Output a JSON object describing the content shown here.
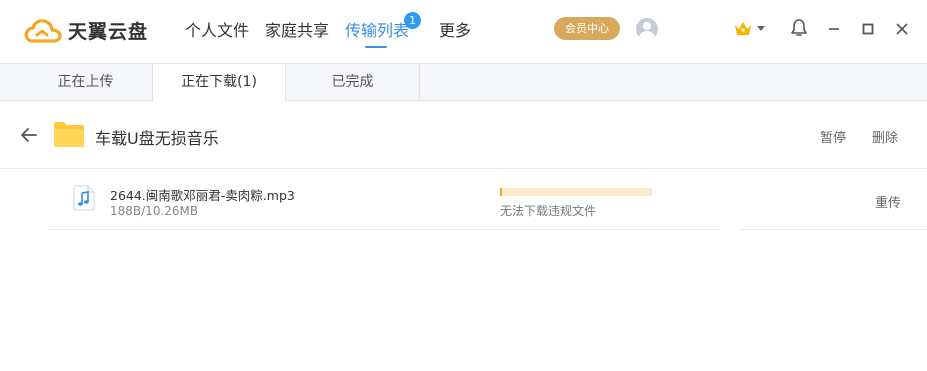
{
  "app": {
    "name": "天翼云盘",
    "brand_color": "#f5a623",
    "accent_color": "#3a8ee6"
  },
  "nav": {
    "items": [
      {
        "label": "个人文件"
      },
      {
        "label": "家庭共享"
      },
      {
        "label": "传输列表",
        "badge": "1",
        "active": true
      },
      {
        "label": "更多"
      }
    ]
  },
  "header": {
    "member_button": "会员中心",
    "icons": [
      "crown-icon",
      "bell-icon",
      "minimize-icon",
      "maximize-icon",
      "close-icon"
    ]
  },
  "tabs": [
    {
      "label": "正在上传"
    },
    {
      "label": "正在下载(1)",
      "active": true
    },
    {
      "label": "已完成"
    }
  ],
  "folder": {
    "name": "车载U盘无损音乐",
    "actions": {
      "pause": "暂停",
      "delete": "删除"
    }
  },
  "files": [
    {
      "name": "2644.闽南歌邓丽君-卖肉粽.mp3",
      "size": "188B/10.26MB",
      "progress": 0.012,
      "status": "无法下载违规文件",
      "action": "重传"
    }
  ]
}
